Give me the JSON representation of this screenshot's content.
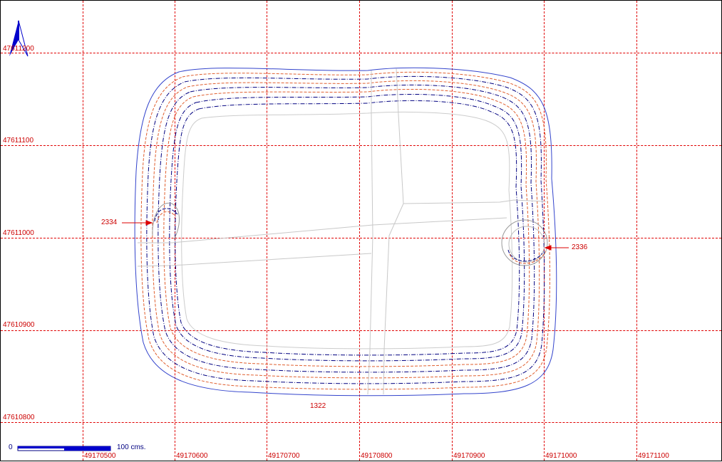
{
  "map": {
    "north_arrow": "north-arrow-icon",
    "x_labels": [
      "49170500",
      "49170600",
      "49170700",
      "49170800",
      "49170900",
      "49171000",
      "49171100"
    ],
    "y_labels": [
      "47611200",
      "47611100",
      "47611000",
      "47610900",
      "47610800"
    ],
    "features": [
      {
        "id": "2334",
        "label": "2334"
      },
      {
        "id": "2336",
        "label": "2336"
      },
      {
        "id": "1322",
        "label": "1322"
      }
    ],
    "scale": {
      "start": "0",
      "end": "100 cms."
    },
    "colors": {
      "grid": "#e00000",
      "outline": "#3344cc",
      "contour_blue": "#000080",
      "contour_orange": "#e06030",
      "roads": "#c8c8c8"
    }
  }
}
